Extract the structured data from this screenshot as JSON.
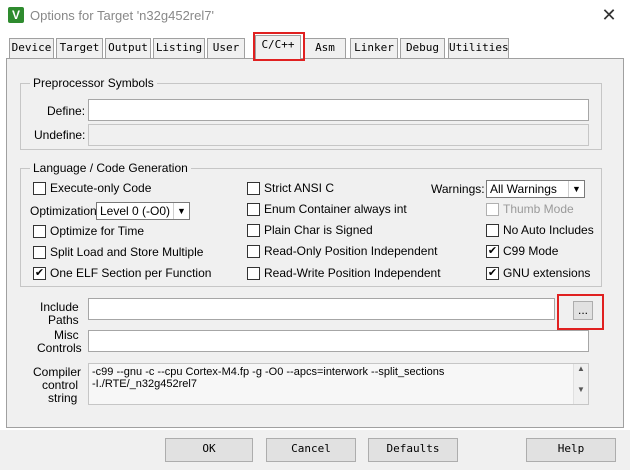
{
  "window": {
    "title": "Options for Target 'n32g452rel7'",
    "icon_letter": "V",
    "close_glyph": "✕"
  },
  "tabs": [
    "Device",
    "Target",
    "Output",
    "Listing",
    "User",
    "C/C++",
    "Asm",
    "Linker",
    "Debug",
    "Utilities"
  ],
  "active_tab": "C/C++",
  "highlight_color": "#e02020",
  "preprocessor": {
    "title": "Preprocessor Symbols",
    "define_label": "Define:",
    "define_value": "",
    "undefine_label": "Undefine:",
    "undefine_value": ""
  },
  "language": {
    "title": "Language / Code Generation",
    "execute_only": {
      "label": "Execute-only Code",
      "checked": false
    },
    "optimization_label": "Optimization:",
    "optimization_value": "Level 0 (-O0)",
    "optimize_time": {
      "label": "Optimize for Time",
      "checked": false
    },
    "split_load": {
      "label": "Split Load and Store Multiple",
      "checked": false
    },
    "one_elf": {
      "label": "One ELF Section per Function",
      "checked": true
    },
    "strict_ansi": {
      "label": "Strict ANSI C",
      "checked": false
    },
    "enum_container": {
      "label": "Enum Container always int",
      "checked": false
    },
    "plain_char": {
      "label": "Plain Char is Signed",
      "checked": false
    },
    "ro_position": {
      "label": "Read-Only Position Independent",
      "checked": false
    },
    "rw_position": {
      "label": "Read-Write Position Independent",
      "checked": false
    },
    "warnings_label": "Warnings:",
    "warnings_value": "All Warnings",
    "thumb_mode": {
      "label": "Thumb Mode",
      "checked": false,
      "disabled": true
    },
    "no_auto_includes": {
      "label": "No Auto Includes",
      "checked": false
    },
    "c99_mode": {
      "label": "C99 Mode",
      "checked": true
    },
    "gnu_extensions": {
      "label": "GNU extensions",
      "checked": true
    }
  },
  "include_paths": {
    "label_line1": "Include",
    "label_line2": "Paths",
    "value": "",
    "browse_label": "..."
  },
  "misc_controls": {
    "label_line1": "Misc",
    "label_line2": "Controls",
    "value": ""
  },
  "compiler_string": {
    "label_line1": "Compiler",
    "label_line2": "control",
    "label_line3": "string",
    "text": "-c99 --gnu -c --cpu Cortex-M4.fp -g -O0 --apcs=interwork --split_sections\n-I./RTE/_n32g452rel7"
  },
  "buttons": {
    "ok": "OK",
    "cancel": "Cancel",
    "defaults": "Defaults",
    "help": "Help"
  }
}
